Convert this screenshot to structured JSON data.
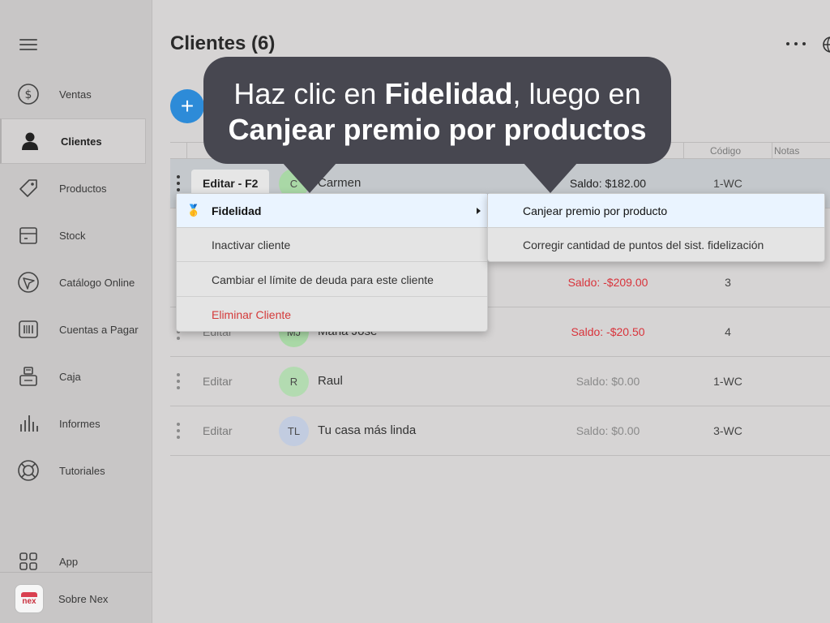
{
  "sidebar": {
    "items": [
      {
        "label": "Ventas",
        "icon": "dollar-circle-icon"
      },
      {
        "label": "Clientes",
        "icon": "person-icon"
      },
      {
        "label": "Productos",
        "icon": "tag-icon"
      },
      {
        "label": "Stock",
        "icon": "box-icon"
      },
      {
        "label": "Catálogo Online",
        "icon": "catalog-icon"
      },
      {
        "label": "Cuentas a Pagar",
        "icon": "barcode-icon"
      },
      {
        "label": "Caja",
        "icon": "register-icon"
      },
      {
        "label": "Informes",
        "icon": "bar-chart-icon"
      },
      {
        "label": "Tutoriales",
        "icon": "lifebuoy-icon"
      }
    ],
    "app_label": "App",
    "about_label": "Sobre Nex",
    "logo_text": "nex"
  },
  "header": {
    "title": "Clientes (6)"
  },
  "table": {
    "columns": {
      "code": "Código",
      "notes": "Notas"
    },
    "rows": [
      {
        "edit": "Editar - F2",
        "initials": "C",
        "name": "Carmen",
        "balance": "Saldo: $182.00",
        "code": "1-WC",
        "avatar_color": "#a9d8a6",
        "negative": false
      },
      {
        "edit": "Editar",
        "initials": "",
        "name": "",
        "balance": "Saldo: -$209.00",
        "code": "3",
        "avatar_color": "#c9c7c7",
        "negative": true
      },
      {
        "edit": "Editar",
        "initials": "MJ",
        "name": "Maria Jose",
        "balance": "Saldo: -$20.50",
        "code": "4",
        "avatar_color": "#a9d8a6",
        "negative": true
      },
      {
        "edit": "Editar",
        "initials": "R",
        "name": "Raul",
        "balance": "Saldo: $0.00",
        "code": "1-WC",
        "avatar_color": "#b3dbb1",
        "negative": false
      },
      {
        "edit": "Editar",
        "initials": "TL",
        "name": "Tu casa más linda",
        "balance": "Saldo: $0.00",
        "code": "3-WC",
        "avatar_color": "#c2cce0",
        "negative": false
      }
    ]
  },
  "context_menu": {
    "items": [
      "Fidelidad",
      "Inactivar cliente",
      "Cambiar el límite de deuda para este cliente",
      "Eliminar Cliente"
    ],
    "fidelity_icon": "🥇"
  },
  "submenu": {
    "items": [
      "Canjear premio por producto",
      "Corregir cantidad de puntos del sist. fidelización"
    ]
  },
  "tooltip": {
    "line1_a": "Haz clic en ",
    "line1_b": "Fidelidad",
    "line1_c": ", luego en",
    "line2": "Canjear premio por productos"
  },
  "colors": {
    "accent": "#2d8bd8",
    "danger": "#d8333b",
    "tooltip_bg": "#474750"
  }
}
